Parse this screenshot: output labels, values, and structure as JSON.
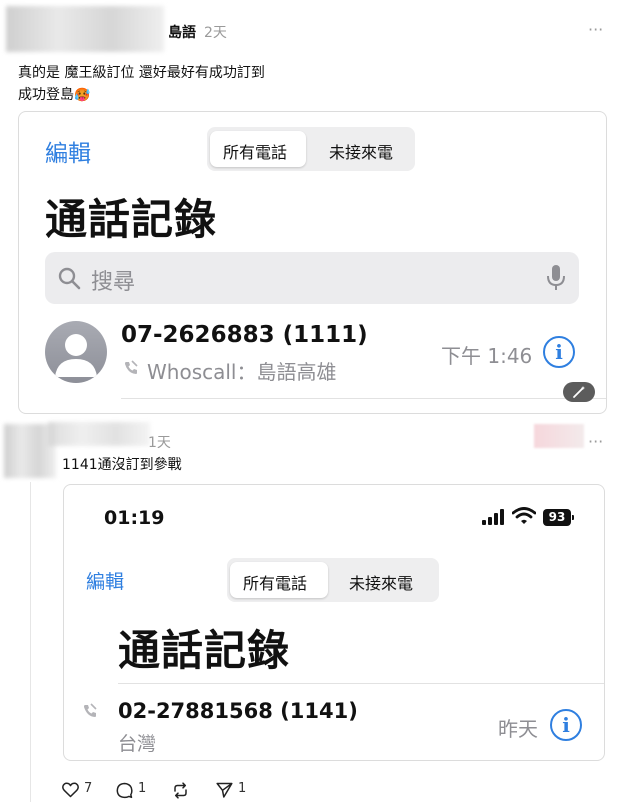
{
  "post1": {
    "username": "島語",
    "time": "2天",
    "more": "···",
    "line1": "真的是 魔王級訂位 還好最好有成功訂到",
    "line2": "成功登島",
    "emoji": "🥵",
    "screenshot": {
      "edit": "編輯",
      "tabs": [
        "所有電話",
        "未接來電"
      ],
      "title": "通話記錄",
      "search_placeholder": "搜尋",
      "entry": {
        "number": "07-2626883 (1111)",
        "source": "Whoscall：島語高雄",
        "time": "下午 1:46"
      }
    }
  },
  "post2": {
    "time": "1天",
    "more": "···",
    "text": "1141通沒訂到參戰",
    "screenshot": {
      "clock": "01:19",
      "battery": "93",
      "edit": "編輯",
      "tabs": [
        "所有電話",
        "未接來電"
      ],
      "title": "通話記錄",
      "entry": {
        "number": "02-27881568 (1141)",
        "location": "台灣",
        "time": "昨天"
      }
    },
    "actions": {
      "likes": "7",
      "comments": "1",
      "shares": "1"
    }
  }
}
